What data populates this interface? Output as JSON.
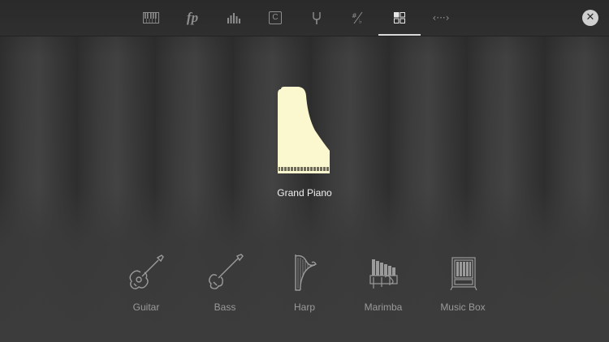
{
  "toolbar": {
    "tabs": [
      {
        "id": "keyboard",
        "icon": "piano-keys-icon"
      },
      {
        "id": "dynamics",
        "icon": "fp-dynamics-icon",
        "text": "fp"
      },
      {
        "id": "levels",
        "icon": "equalizer-bars-icon"
      },
      {
        "id": "chord",
        "icon": "chord-c-icon",
        "text": "C"
      },
      {
        "id": "tuning",
        "icon": "tuning-fork-icon"
      },
      {
        "id": "transpose",
        "icon": "sharp-flat-icon"
      },
      {
        "id": "instruments",
        "icon": "grid-icon",
        "active": true
      },
      {
        "id": "range",
        "icon": "range-arrows-icon",
        "text": "‹···›"
      }
    ],
    "close_icon": "close-icon"
  },
  "featured": {
    "label": "Grand Piano",
    "icon": "grand-piano-icon",
    "color": "#fbf7cf"
  },
  "instruments": [
    {
      "label": "Guitar",
      "icon": "guitar-icon"
    },
    {
      "label": "Bass",
      "icon": "bass-guitar-icon"
    },
    {
      "label": "Harp",
      "icon": "harp-icon"
    },
    {
      "label": "Marimba",
      "icon": "marimba-icon"
    },
    {
      "label": "Music Box",
      "icon": "music-box-icon"
    }
  ],
  "colors": {
    "active": "#e6e6e6",
    "inactive": "#8d8d8d",
    "label": "#9a9a9a",
    "accent_piano": "#fbf7cf"
  }
}
